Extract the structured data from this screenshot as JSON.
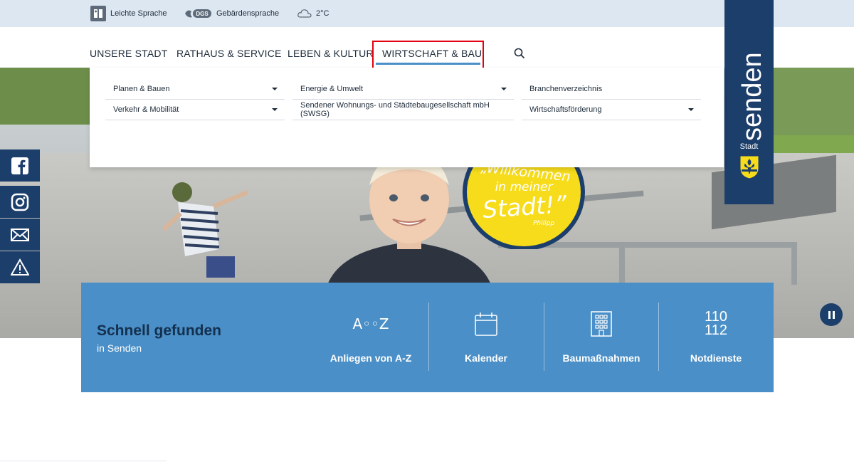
{
  "utility": {
    "easy_language": "Leichte Sprache",
    "sign_language_badge": "DGS",
    "sign_language": "Gebärdensprache",
    "weather_temp": "2°C"
  },
  "nav": {
    "items": [
      "UNSERE STADT",
      "RATHAUS & SERVICE",
      "LEBEN & KULTUR",
      "WIRTSCHAFT & BAU"
    ],
    "active": "WIRTSCHAFT & BAU"
  },
  "dropdown": {
    "col1": [
      "Planen & Bauen",
      "Verkehr & Mobilität"
    ],
    "col2": [
      "Energie & Umwelt",
      "Sendener Wohnungs- und Städtebaugesellschaft mbH (SWSG)"
    ],
    "col3": [
      "Branchenverzeichnis",
      "Wirtschaftsförderung"
    ]
  },
  "logo": {
    "name": "senden",
    "sub": "Stadt"
  },
  "badge": {
    "line1": "„Willkommen",
    "line2": "in meiner",
    "line3": "Stadt!”",
    "signature": "Philipp"
  },
  "quick_find": {
    "title": "Schnell gefunden",
    "subtitle": "in Senden",
    "items": [
      {
        "label": "Anliegen von A-Z",
        "icon": "az-icon",
        "icon_text": "A◦◦Z"
      },
      {
        "label": "Kalender",
        "icon": "calendar-icon"
      },
      {
        "label": "Baumaßnahmen",
        "icon": "building-icon"
      },
      {
        "label": "Notdienste",
        "icon": "emergency-numbers-icon",
        "icon_text_1": "110",
        "icon_text_2": "112"
      }
    ]
  },
  "colors": {
    "brand_navy": "#1c3e6b",
    "accent_blue": "#4a8fc7",
    "focus_red": "#e3000f",
    "topbar": "#dde7f1"
  }
}
